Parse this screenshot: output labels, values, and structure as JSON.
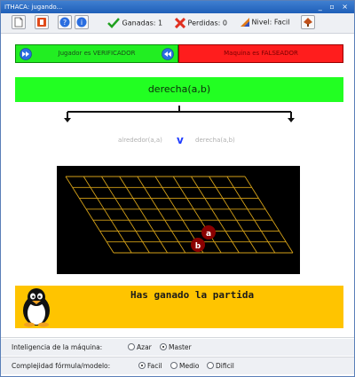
{
  "window": {
    "title": "ITHACA: jugando...",
    "controls": "_ ▫ ×"
  },
  "toolbar": {
    "ganadas_label": "Ganadas:",
    "ganadas_value": "1",
    "perdidas_label": "Perdidas:",
    "perdidas_value": "0",
    "nivel_label": "Nivel:",
    "nivel_value": "Facil",
    "icons": [
      "new-document-icon",
      "stop-icon",
      "help-icon",
      "info-icon",
      "check-icon",
      "cross-icon",
      "level-bars-icon",
      "settings-icon"
    ]
  },
  "roles": {
    "player": "Jugador es VERIFICADOR",
    "machine": "Maquina es FALSEADOR",
    "player_color": "#22ee22",
    "machine_color": "#ff1d1d"
  },
  "formula": {
    "main": "derecha(a,b)",
    "left": "alrededor(a,a)",
    "operator": "v",
    "right": "derecha(a,b)"
  },
  "board": {
    "grid_color": "#d4a017",
    "pieces": [
      {
        "label": "a",
        "color": "#8b0000"
      },
      {
        "label": "b",
        "color": "#8b0000"
      }
    ]
  },
  "result": {
    "message": "Has ganado la partida",
    "color": "#ffc400"
  },
  "options": {
    "intelligence_label": "Inteligencia de la máquina:",
    "intelligence_options": [
      {
        "label": "Azar",
        "selected": false
      },
      {
        "label": "Master",
        "selected": true
      }
    ],
    "complexity_label": "Complejidad fórmula/modelo:",
    "complexity_options": [
      {
        "label": "Facil",
        "selected": true
      },
      {
        "label": "Medio",
        "selected": false
      },
      {
        "label": "Dificil",
        "selected": false
      }
    ]
  }
}
